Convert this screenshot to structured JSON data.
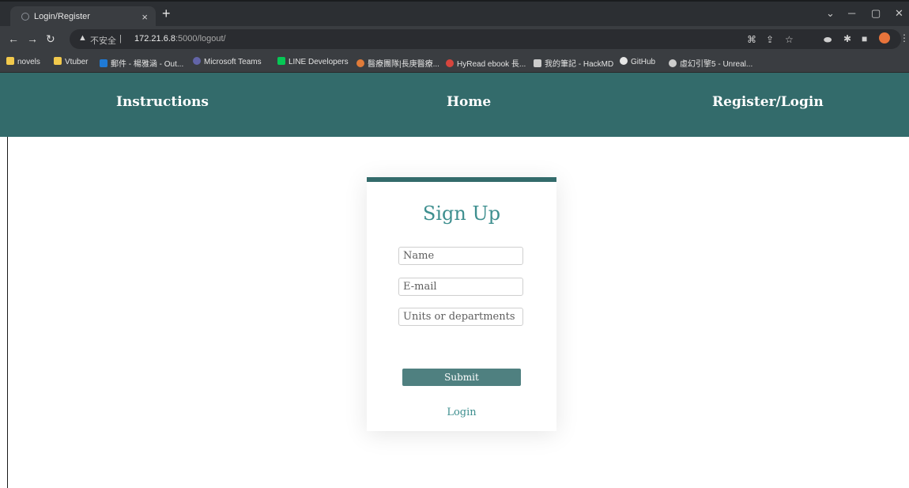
{
  "browser": {
    "tab_title": "Login/Register",
    "tab_close": "×",
    "new_tab": "+",
    "insecure_label": "不安全",
    "url_host": "172.21.6.8",
    "url_path": ":5000/logout/",
    "bookmarks": [
      {
        "label": "novels",
        "icon": "folder-icon",
        "color": "#f2c94c"
      },
      {
        "label": "Vtuber",
        "icon": "folder-icon",
        "color": "#f2c94c"
      },
      {
        "label": "郵件 - 楊雅涵 - Out...",
        "icon": "outlook-icon",
        "color": "#1f7ad6"
      },
      {
        "label": "Microsoft Teams",
        "icon": "teams-icon",
        "color": "#6264a7"
      },
      {
        "label": "LINE Developers",
        "icon": "line-icon",
        "color": "#06c755"
      },
      {
        "label": "醫療團隊|長庚醫療...",
        "icon": "hospital-icon",
        "color": "#e07b39"
      },
      {
        "label": "HyRead ebook 長...",
        "icon": "hyread-icon",
        "color": "#d6453d"
      },
      {
        "label": "我的筆記 - HackMD",
        "icon": "hackmd-icon",
        "color": "#cccccc"
      },
      {
        "label": "GitHub",
        "icon": "github-icon",
        "color": "#e6e6e6"
      },
      {
        "label": "虛幻引擎5 - Unreal...",
        "icon": "unreal-icon",
        "color": "#cccccc"
      }
    ]
  },
  "nav": {
    "instructions": "Instructions",
    "home": "Home",
    "register_login": "Register/Login"
  },
  "form": {
    "title": "Sign Up",
    "name_placeholder": "Name",
    "email_placeholder": "E-mail",
    "units_placeholder": "Units or departments",
    "submit_label": "Submit",
    "login_link": "Login"
  },
  "colors": {
    "accent": "#336b6b",
    "title_teal": "#3e8f8f",
    "button": "#4f8080"
  }
}
